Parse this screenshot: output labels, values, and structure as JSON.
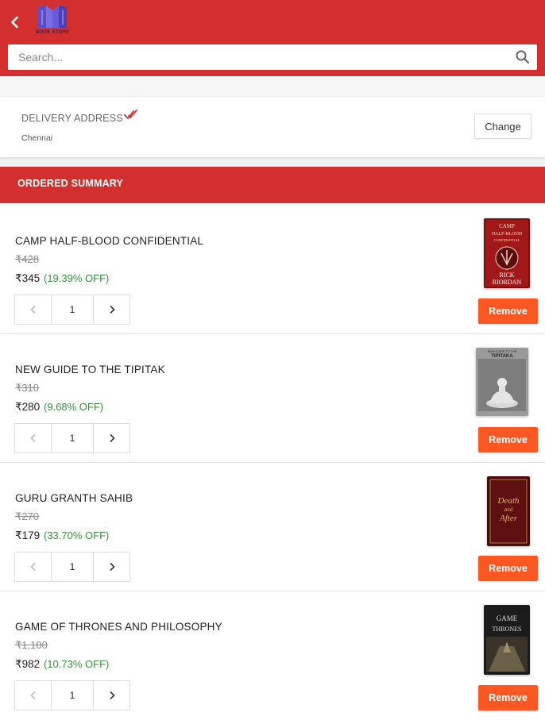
{
  "header": {
    "logo_text": "BOOK STORE",
    "brand_color": "#d32f2f",
    "back_icon": "chevron-left-icon"
  },
  "search": {
    "placeholder": "Search...",
    "icon": "search-icon"
  },
  "delivery": {
    "label": "DELIVERY ADDRESS",
    "city": "Chennai",
    "change_label": "Change",
    "verified_icon": "double-check-icon"
  },
  "summary": {
    "title": "ORDERED SUMMARY"
  },
  "items": [
    {
      "title": "CAMP HALF-BLOOD CONFIDENTIAL",
      "original_price": "₹428",
      "price": "₹345",
      "discount": "(19.39% OFF)",
      "quantity": "1",
      "remove_label": "Remove",
      "cover": {
        "line1": "CAMP",
        "line2": "HALF-BLOOD",
        "line3": "CONFIDENTIAL",
        "author1": "RICK",
        "author2": "RIORDAN"
      }
    },
    {
      "title": "NEW GUIDE TO THE TIPITAK",
      "original_price": "₹310",
      "price": "₹280",
      "discount": "(9.68% OFF)",
      "quantity": "1",
      "remove_label": "Remove",
      "cover": {
        "line1": "NEW GUIDE TO THE",
        "line2": "TIPITAKA"
      }
    },
    {
      "title": "GURU GRANTH SAHIB",
      "original_price": "₹270",
      "price": "₹179",
      "discount": "(33.70% OFF)",
      "quantity": "1",
      "remove_label": "Remove",
      "cover": {
        "line1": "Death",
        "line2": "and",
        "line3": "After"
      }
    },
    {
      "title": "GAME OF THRONES AND PHILOSOPHY",
      "original_price": "₹1,100",
      "price": "₹982",
      "discount": "(10.73% OFF)",
      "quantity": "1",
      "remove_label": "Remove",
      "cover": {
        "line1": "GAME",
        "line2": "THRONES"
      }
    }
  ]
}
